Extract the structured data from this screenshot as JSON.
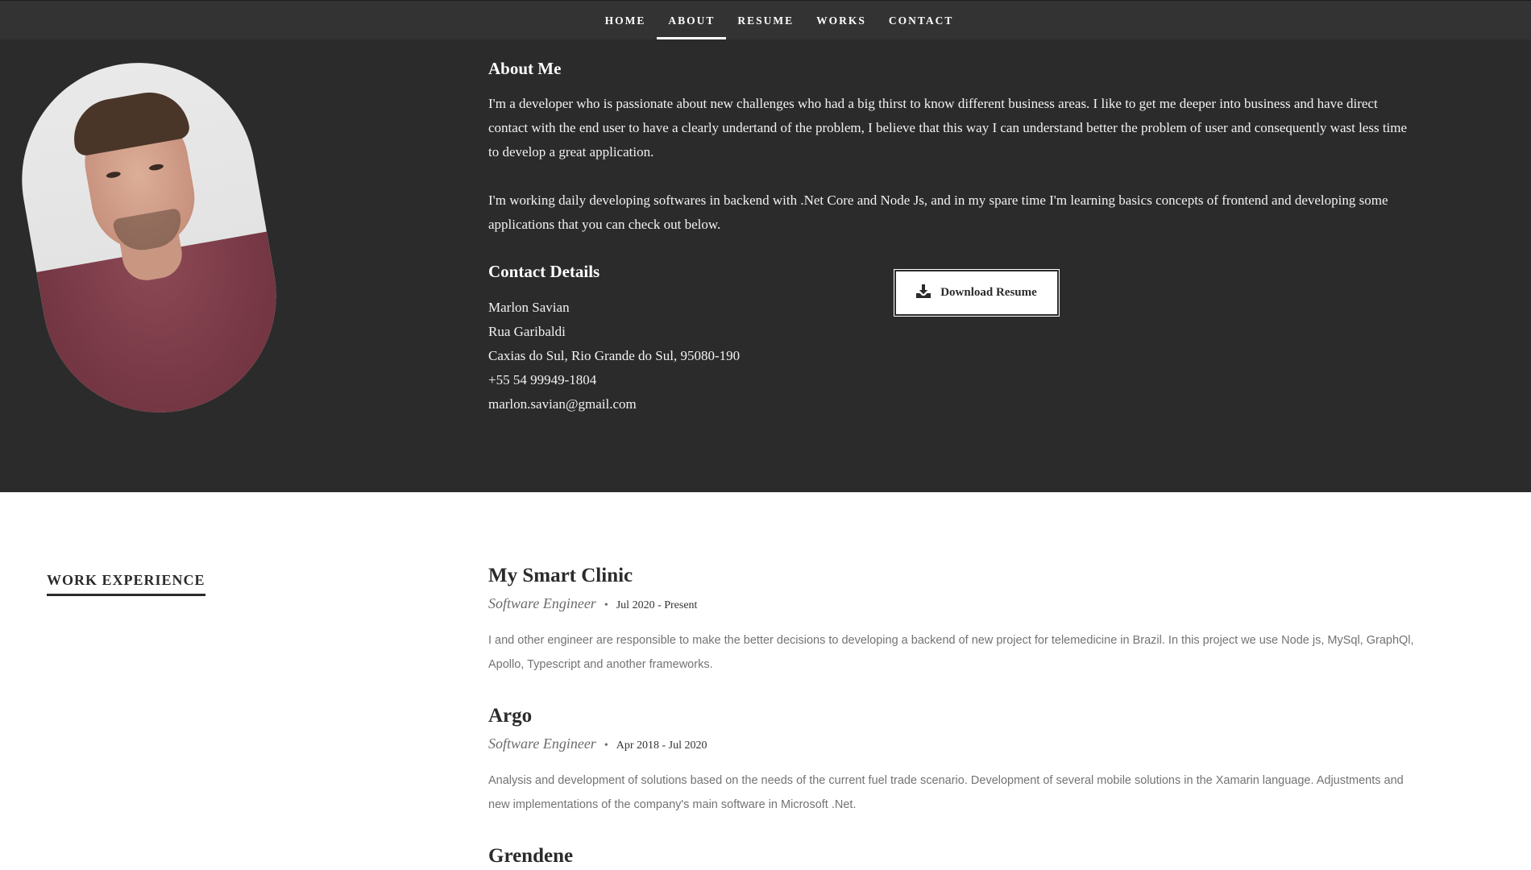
{
  "nav": {
    "items": [
      {
        "label": "HOME"
      },
      {
        "label": "ABOUT"
      },
      {
        "label": "RESUME"
      },
      {
        "label": "WORKS"
      },
      {
        "label": "CONTACT"
      }
    ],
    "active": "ABOUT"
  },
  "about": {
    "title": "About Me",
    "paragraphs": [
      "I'm a developer who is passionate about new challenges who had a big thirst to know different business areas. I like to get me deeper into business and have direct contact with the end user to have a clearly undertand of the problem, I believe that this way I can understand better the problem of user and consequently wast less time to develop a great application.",
      "I'm working daily developing softwares in backend with .Net Core and Node Js, and in my spare time I'm learning basics concepts of frontend and developing some applications that you can check out below."
    ]
  },
  "contact": {
    "title": "Contact Details",
    "lines": [
      "Marlon Savian",
      "Rua Garibaldi",
      "Caxias do Sul, Rio Grande do Sul, 95080-190",
      "+55 54 99949-1804",
      "marlon.savian@gmail.com"
    ],
    "download_label": "Download Resume",
    "download_icon": "download-icon"
  },
  "work": {
    "heading": "WORK EXPERIENCE",
    "jobs": [
      {
        "company": "My Smart Clinic",
        "role": "Software Engineer",
        "dates": "Jul 2020 - Present",
        "description": "I and other engineer are responsible to make the better decisions to developing a backend of new project for telemedicine in Brazil. In this project we use Node js, MySql, GraphQl, Apollo, Typescript and another frameworks."
      },
      {
        "company": "Argo",
        "role": "Software Engineer",
        "dates": "Apr 2018 - Jul 2020",
        "description": "Analysis and development of solutions based on the needs of the current fuel trade scenario. Development of several mobile solutions in the Xamarin language. Adjustments and new implementations of the company's main software in Microsoft .Net."
      },
      {
        "company": "Grendene"
      }
    ]
  },
  "colors": {
    "dark_bg": "#2b2b2b",
    "nav_bg": "#333333",
    "text_light": "#ffffff",
    "muted": "#737373"
  }
}
